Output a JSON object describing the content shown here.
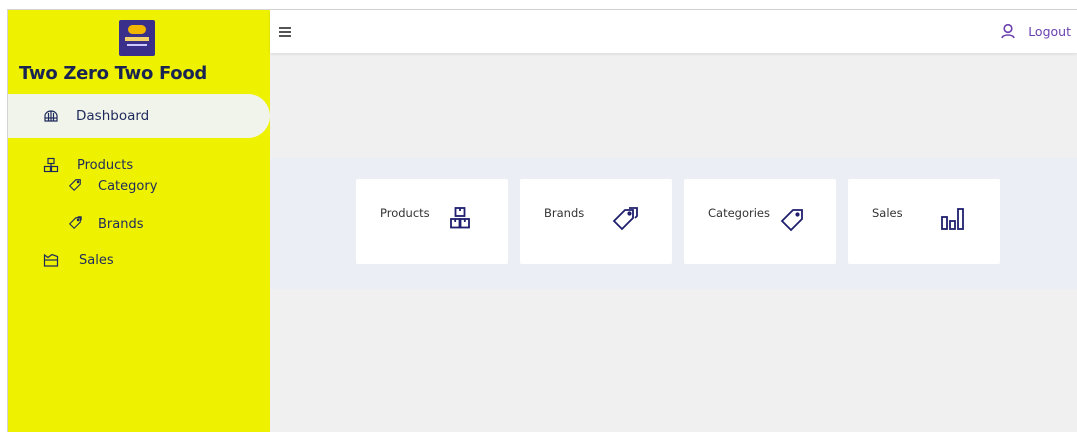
{
  "sidebar": {
    "brand_title": "Two Zero Two Food",
    "items": [
      {
        "label": "Dashboard",
        "icon": "dashboard-icon",
        "active": true
      },
      {
        "label": "Products",
        "icon": "products-icon"
      },
      {
        "label": "Category",
        "icon": "tag-icon"
      },
      {
        "label": "Brands",
        "icon": "tag-icon"
      },
      {
        "label": "Sales",
        "icon": "sales-icon"
      }
    ]
  },
  "topbar": {
    "menu_icon": "hamburger-icon",
    "logout_label": "Logout",
    "user_icon": "user-icon"
  },
  "cards": [
    {
      "label": "Products",
      "icon": "boxes-icon"
    },
    {
      "label": "Brands",
      "icon": "tags-icon"
    },
    {
      "label": "Categories",
      "icon": "tag-icon"
    },
    {
      "label": "Sales",
      "icon": "bar-chart-icon"
    }
  ],
  "colors": {
    "sidebar_bg": "#eef200",
    "active_item_bg": "#f1f4ea",
    "nav_text": "#1f2a5c",
    "logout_accent": "#6a3fb0",
    "card_icon": "#1f1f6e"
  }
}
